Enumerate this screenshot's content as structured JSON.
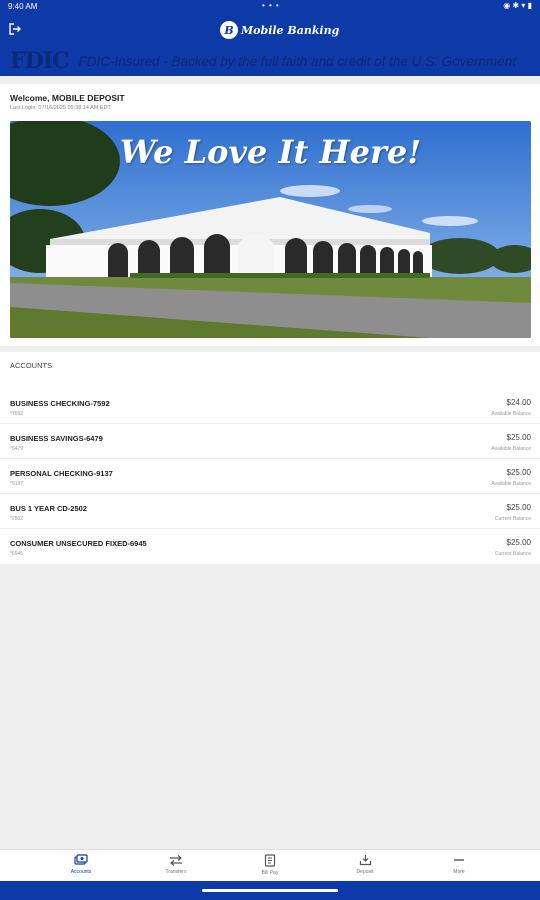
{
  "status_bar": {
    "time": "9:40 AM",
    "dots": "• • •",
    "icons": "◉ ✱ ▾ ▮"
  },
  "app_bar": {
    "logo_letter": "B",
    "title": "Mobile Banking"
  },
  "fdic": {
    "mark": "FDIC",
    "text": "FDIC-Insured - Backed by the full faith and credit of the U.S. Government"
  },
  "welcome": {
    "title": "Welcome, MOBILE DEPOSIT",
    "last_login": "Last Login: 07/16/2025 09:38:14 AM EDT"
  },
  "banner": {
    "title": "We Love It Here!"
  },
  "accounts": {
    "header": "ACCOUNTS",
    "items": [
      {
        "name": "BUSINESS CHECKING-7592",
        "number": "*7592",
        "balance": "$24.00",
        "balance_label": "Available Balance"
      },
      {
        "name": "BUSINESS SAVINGS-6479",
        "number": "*6479",
        "balance": "$25.00",
        "balance_label": "Available Balance"
      },
      {
        "name": "PERSONAL CHECKING-9137",
        "number": "*9137",
        "balance": "$25.00",
        "balance_label": "Available Balance"
      },
      {
        "name": "BUS 1 YEAR CD-2502",
        "number": "*2502",
        "balance": "$25.00",
        "balance_label": "Current Balance"
      },
      {
        "name": "CONSUMER UNSECURED FIXED-6945",
        "number": "*6945",
        "balance": "$25.00",
        "balance_label": "Current Balance"
      }
    ]
  },
  "bottom_nav": [
    {
      "label": "Accounts",
      "icon": "accounts-icon",
      "active": true
    },
    {
      "label": "Transfers",
      "icon": "transfer-icon",
      "active": false
    },
    {
      "label": "Bill Pay",
      "icon": "bill-pay-icon",
      "active": false
    },
    {
      "label": "Deposit",
      "icon": "deposit-icon",
      "active": false
    },
    {
      "label": "More",
      "icon": "more-icon",
      "active": false
    }
  ],
  "colors": {
    "brand_blue": "#0d3aa6",
    "fdic_text": "#0a2a78",
    "active_tab": "#0d3aa6"
  }
}
